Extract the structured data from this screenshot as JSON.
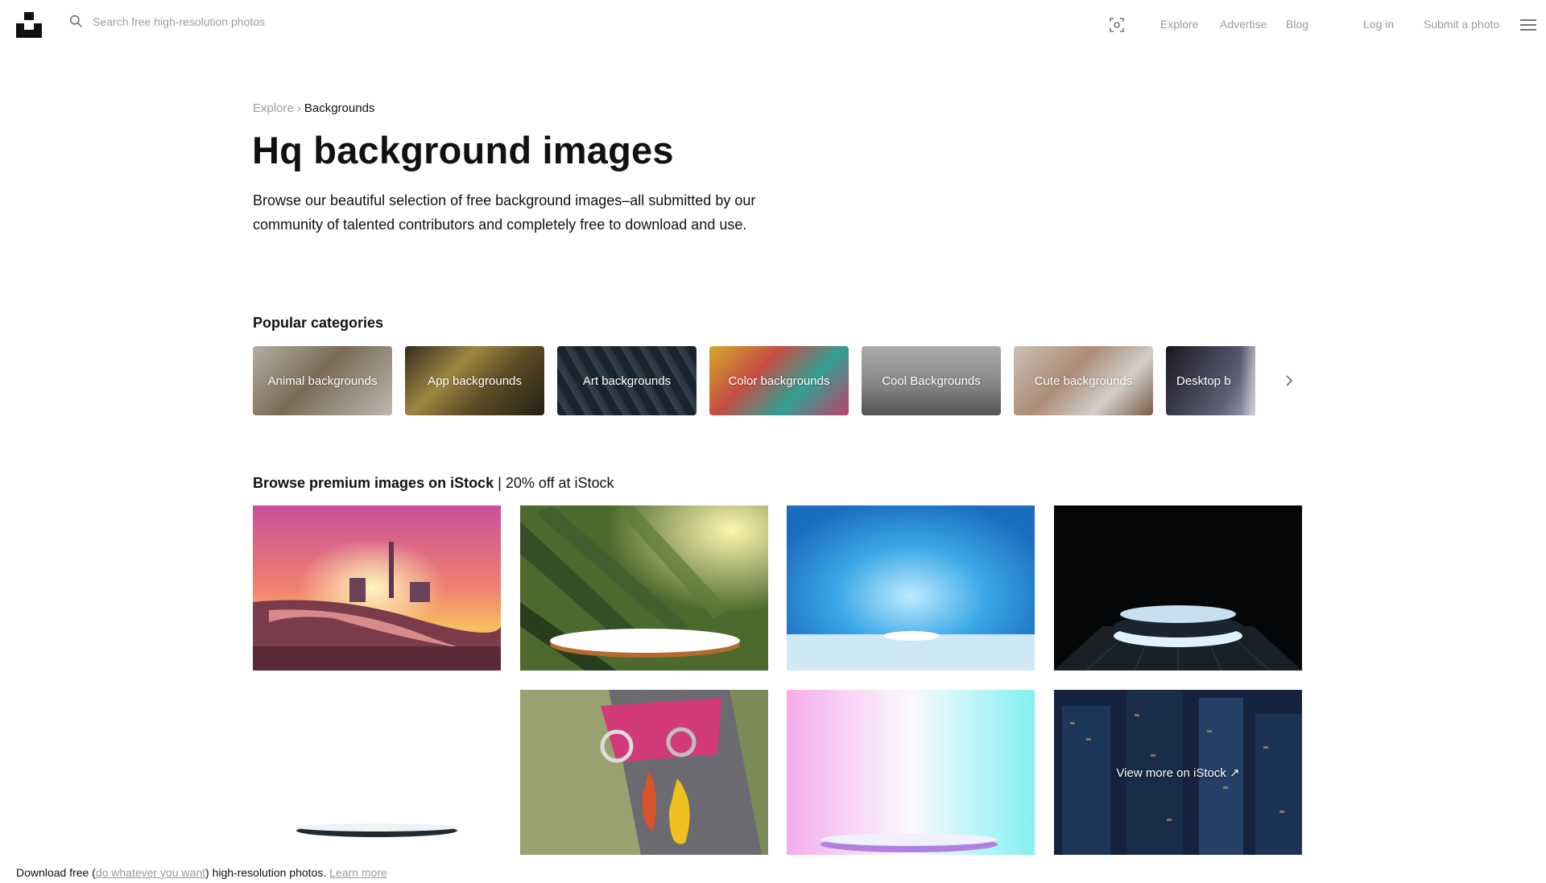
{
  "header": {
    "search_placeholder": "Search free high-resolution photos",
    "nav": {
      "explore": "Explore",
      "advertise": "Advertise",
      "blog": "Blog",
      "login": "Log in",
      "submit": "Submit a photo"
    },
    "icons": [
      "unsplash-logo-icon",
      "search-icon",
      "visual-search-icon",
      "hamburger-menu-icon"
    ]
  },
  "breadcrumb": {
    "explore": "Explore",
    "separator": "›",
    "current": "Backgrounds"
  },
  "hero": {
    "title": "Hq background images",
    "description": "Browse our beautiful selection of free background images–all submitted by our community of talented contributors and completely free to download and use."
  },
  "categories": {
    "title": "Popular categories",
    "items": [
      {
        "label": "Animal backgrounds",
        "color": "#a89a86"
      },
      {
        "label": "App backgrounds",
        "color": "#6b5a33"
      },
      {
        "label": "Art backgrounds",
        "color": "#2b3a48"
      },
      {
        "label": "Color backgrounds",
        "color": "#e0705a"
      },
      {
        "label": "Cool Backgrounds",
        "color": "#8a8a8a"
      },
      {
        "label": "Cute backgrounds",
        "color": "#b59a86"
      },
      {
        "label": "Desktop b",
        "color": "#555a70"
      }
    ]
  },
  "istock": {
    "title_bold": "Browse premium images on iStock",
    "separator": "|",
    "promo": "20% off at iStock",
    "view_more": "View more on iStock ↗"
  },
  "footer": {
    "prefix": "Download free (",
    "link1": "do whatever you want",
    "middle": ") high-resolution photos.",
    "link2": "Learn more"
  },
  "colors": {
    "text": "#111111",
    "muted": "#9b9b9b",
    "background": "#ffffff"
  }
}
